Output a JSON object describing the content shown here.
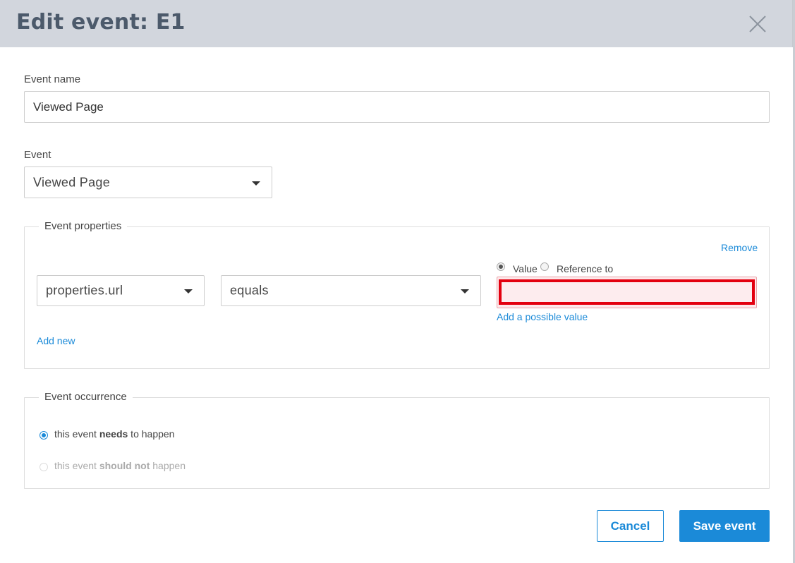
{
  "dialog": {
    "title": "Edit event: E1",
    "close_icon": "close-icon"
  },
  "event_name": {
    "label": "Event name",
    "value": "Viewed Page"
  },
  "event": {
    "label": "Event",
    "selected": "Viewed Page"
  },
  "event_properties": {
    "legend": "Event properties",
    "remove_label": "Remove",
    "property_selected": "properties.url",
    "operator_selected": "equals",
    "value_mode": {
      "value_label": "Value",
      "reference_label": "Reference to",
      "selected": "Value"
    },
    "value": "",
    "add_possible_value_label": "Add a possible value",
    "add_new_label": "Add new"
  },
  "event_occurrence": {
    "legend": "Event occurrence",
    "option1": {
      "pre": "this event ",
      "bold": "needs",
      "post": " to happen",
      "checked": true
    },
    "option2": {
      "pre": "this event ",
      "bold": "should not",
      "post": " happen",
      "checked": false
    }
  },
  "footer": {
    "cancel_label": "Cancel",
    "save_label": "Save event"
  },
  "colors": {
    "accent": "#1b8ad8",
    "header_bg": "#d2d6dd",
    "error_border": "#e3000f"
  }
}
